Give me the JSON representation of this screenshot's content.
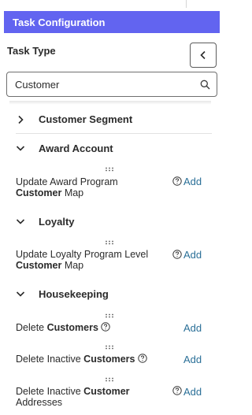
{
  "header": {
    "title": "Task Configuration"
  },
  "task_type": {
    "label": "Task Type"
  },
  "search": {
    "value": "Customer",
    "icon": "search-icon"
  },
  "sections": [
    {
      "title": "Customer Segment",
      "expanded": false
    },
    {
      "title": "Award Account",
      "expanded": true
    },
    {
      "title": "Loyalty",
      "expanded": true
    },
    {
      "title": "Housekeeping",
      "expanded": true
    }
  ],
  "items": [
    {
      "text_plain": "Update Award Program ",
      "text_bold": "Customer",
      "text_tail": " Map",
      "action": "Add"
    },
    {
      "text_plain": "Update Loyalty Program Level ",
      "text_bold": "Customer",
      "text_tail": " Map",
      "action": "Add"
    },
    {
      "text_plain": "Delete ",
      "text_bold": "Customers",
      "text_tail": "",
      "action": "Add"
    },
    {
      "text_plain": "Delete Inactive ",
      "text_bold": "Customers",
      "text_tail": "",
      "action": "Add"
    },
    {
      "text_plain": "Delete Inactive ",
      "text_bold": "Customer",
      "text_tail": " Addresses",
      "action": "Add"
    }
  ],
  "colors": {
    "header_bg": "#6264f0",
    "link": "#2a6f97"
  }
}
